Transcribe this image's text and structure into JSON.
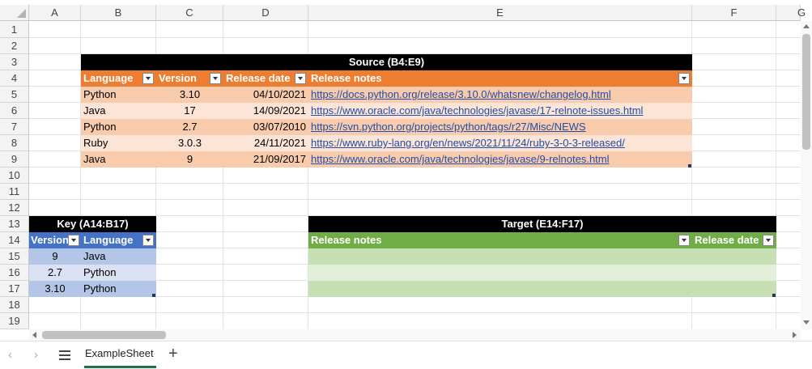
{
  "columns": [
    "A",
    "B",
    "C",
    "D",
    "E",
    "F",
    "G"
  ],
  "rows": [
    "1",
    "2",
    "3",
    "4",
    "5",
    "6",
    "7",
    "8",
    "9",
    "10",
    "11",
    "12",
    "13",
    "14",
    "15",
    "16",
    "17",
    "18",
    "19"
  ],
  "source": {
    "title": "Source (B4:E9)",
    "headers": [
      "Language",
      "Version",
      "Release date",
      "Release notes"
    ],
    "data": [
      [
        "Python",
        "3.10",
        "04/10/2021",
        "https://docs.python.org/release/3.10.0/whatsnew/changelog.html"
      ],
      [
        "Java",
        "17",
        "14/09/2021",
        "https://www.oracle.com/java/technologies/javase/17-relnote-issues.html"
      ],
      [
        "Python",
        "2.7",
        "03/07/2010",
        "https://svn.python.org/projects/python/tags/r27/Misc/NEWS"
      ],
      [
        "Ruby",
        "3.0.3",
        "24/11/2021",
        "https://www.ruby-lang.org/en/news/2021/11/24/ruby-3-0-3-released/"
      ],
      [
        "Java",
        "9",
        "21/09/2017",
        "https://www.oracle.com/java/technologies/javase/9-relnotes.html"
      ]
    ]
  },
  "key": {
    "title": "Key (A14:B17)",
    "headers": [
      "Version",
      "Language"
    ],
    "data": [
      [
        "9",
        "Java"
      ],
      [
        "2.7",
        "Python"
      ],
      [
        "3.10",
        "Python"
      ]
    ]
  },
  "target": {
    "title": "Target (E14:F17)",
    "headers": [
      "Release notes",
      "Release date"
    ]
  },
  "sheet": {
    "name": "ExampleSheet"
  },
  "colors": {
    "source_header": "#ed7d31",
    "source_row_dark": "#f8cbad",
    "source_row_light": "#fce4d6",
    "key_header": "#4472c4",
    "key_row_dark": "#b4c6e7",
    "key_row_light": "#d9e1f2",
    "target_header": "#70ad47",
    "target_row_dark": "#c6e0b4",
    "target_row_light": "#e2efda"
  }
}
